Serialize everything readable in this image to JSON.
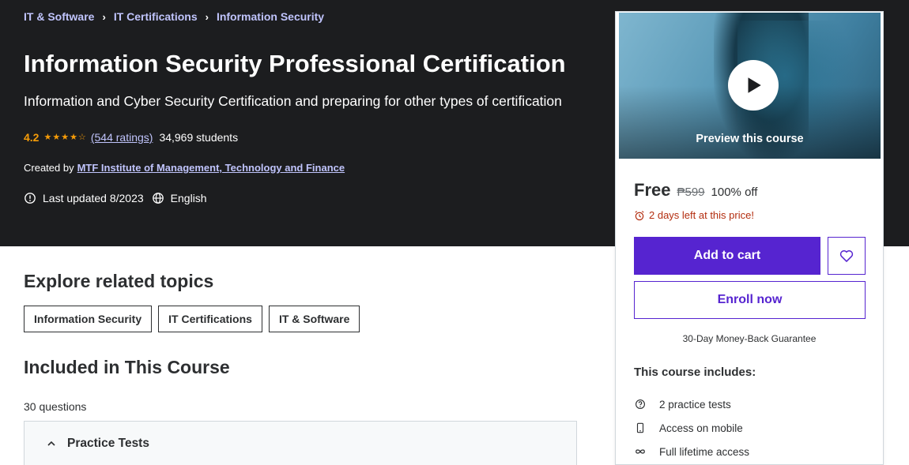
{
  "breadcrumb": [
    "IT & Software",
    "IT Certifications",
    "Information Security"
  ],
  "course": {
    "title": "Information Security Professional Certification",
    "subtitle": "Information and Cyber Security Certification and preparing for other types of certification",
    "rating": "4.2",
    "stars_filled": 4,
    "stars_total": 5,
    "ratings_link": "(544 ratings)",
    "students": "34,969 students",
    "created_by_label": "Created by",
    "author": "MTF Institute of Management, Technology and Finance",
    "last_updated": "Last updated 8/2023",
    "language": "English"
  },
  "sidebar": {
    "preview_label": "Preview this course",
    "price_now": "Free",
    "price_old": "₱599",
    "discount": "100% off",
    "timer_text": "2 days left at this price!",
    "add_to_cart": "Add to cart",
    "enroll_now": "Enroll now",
    "guarantee": "30-Day Money-Back Guarantee",
    "includes_title": "This course includes:",
    "includes": [
      {
        "icon": "question-circle-icon",
        "label": "2 practice tests"
      },
      {
        "icon": "mobile-icon",
        "label": "Access on mobile"
      },
      {
        "icon": "infinity-icon",
        "label": "Full lifetime access"
      }
    ]
  },
  "main": {
    "related_title": "Explore related topics",
    "topics": [
      "Information Security",
      "IT Certifications",
      "IT & Software"
    ],
    "included_title": "Included in This Course",
    "questions": "30 questions",
    "section_label": "Practice Tests"
  },
  "colors": {
    "hero_bg": "#1c1d1f",
    "accent": "#5624d0",
    "link": "#c0c4fc",
    "star": "#f69c08",
    "alert": "#b32d0f"
  }
}
